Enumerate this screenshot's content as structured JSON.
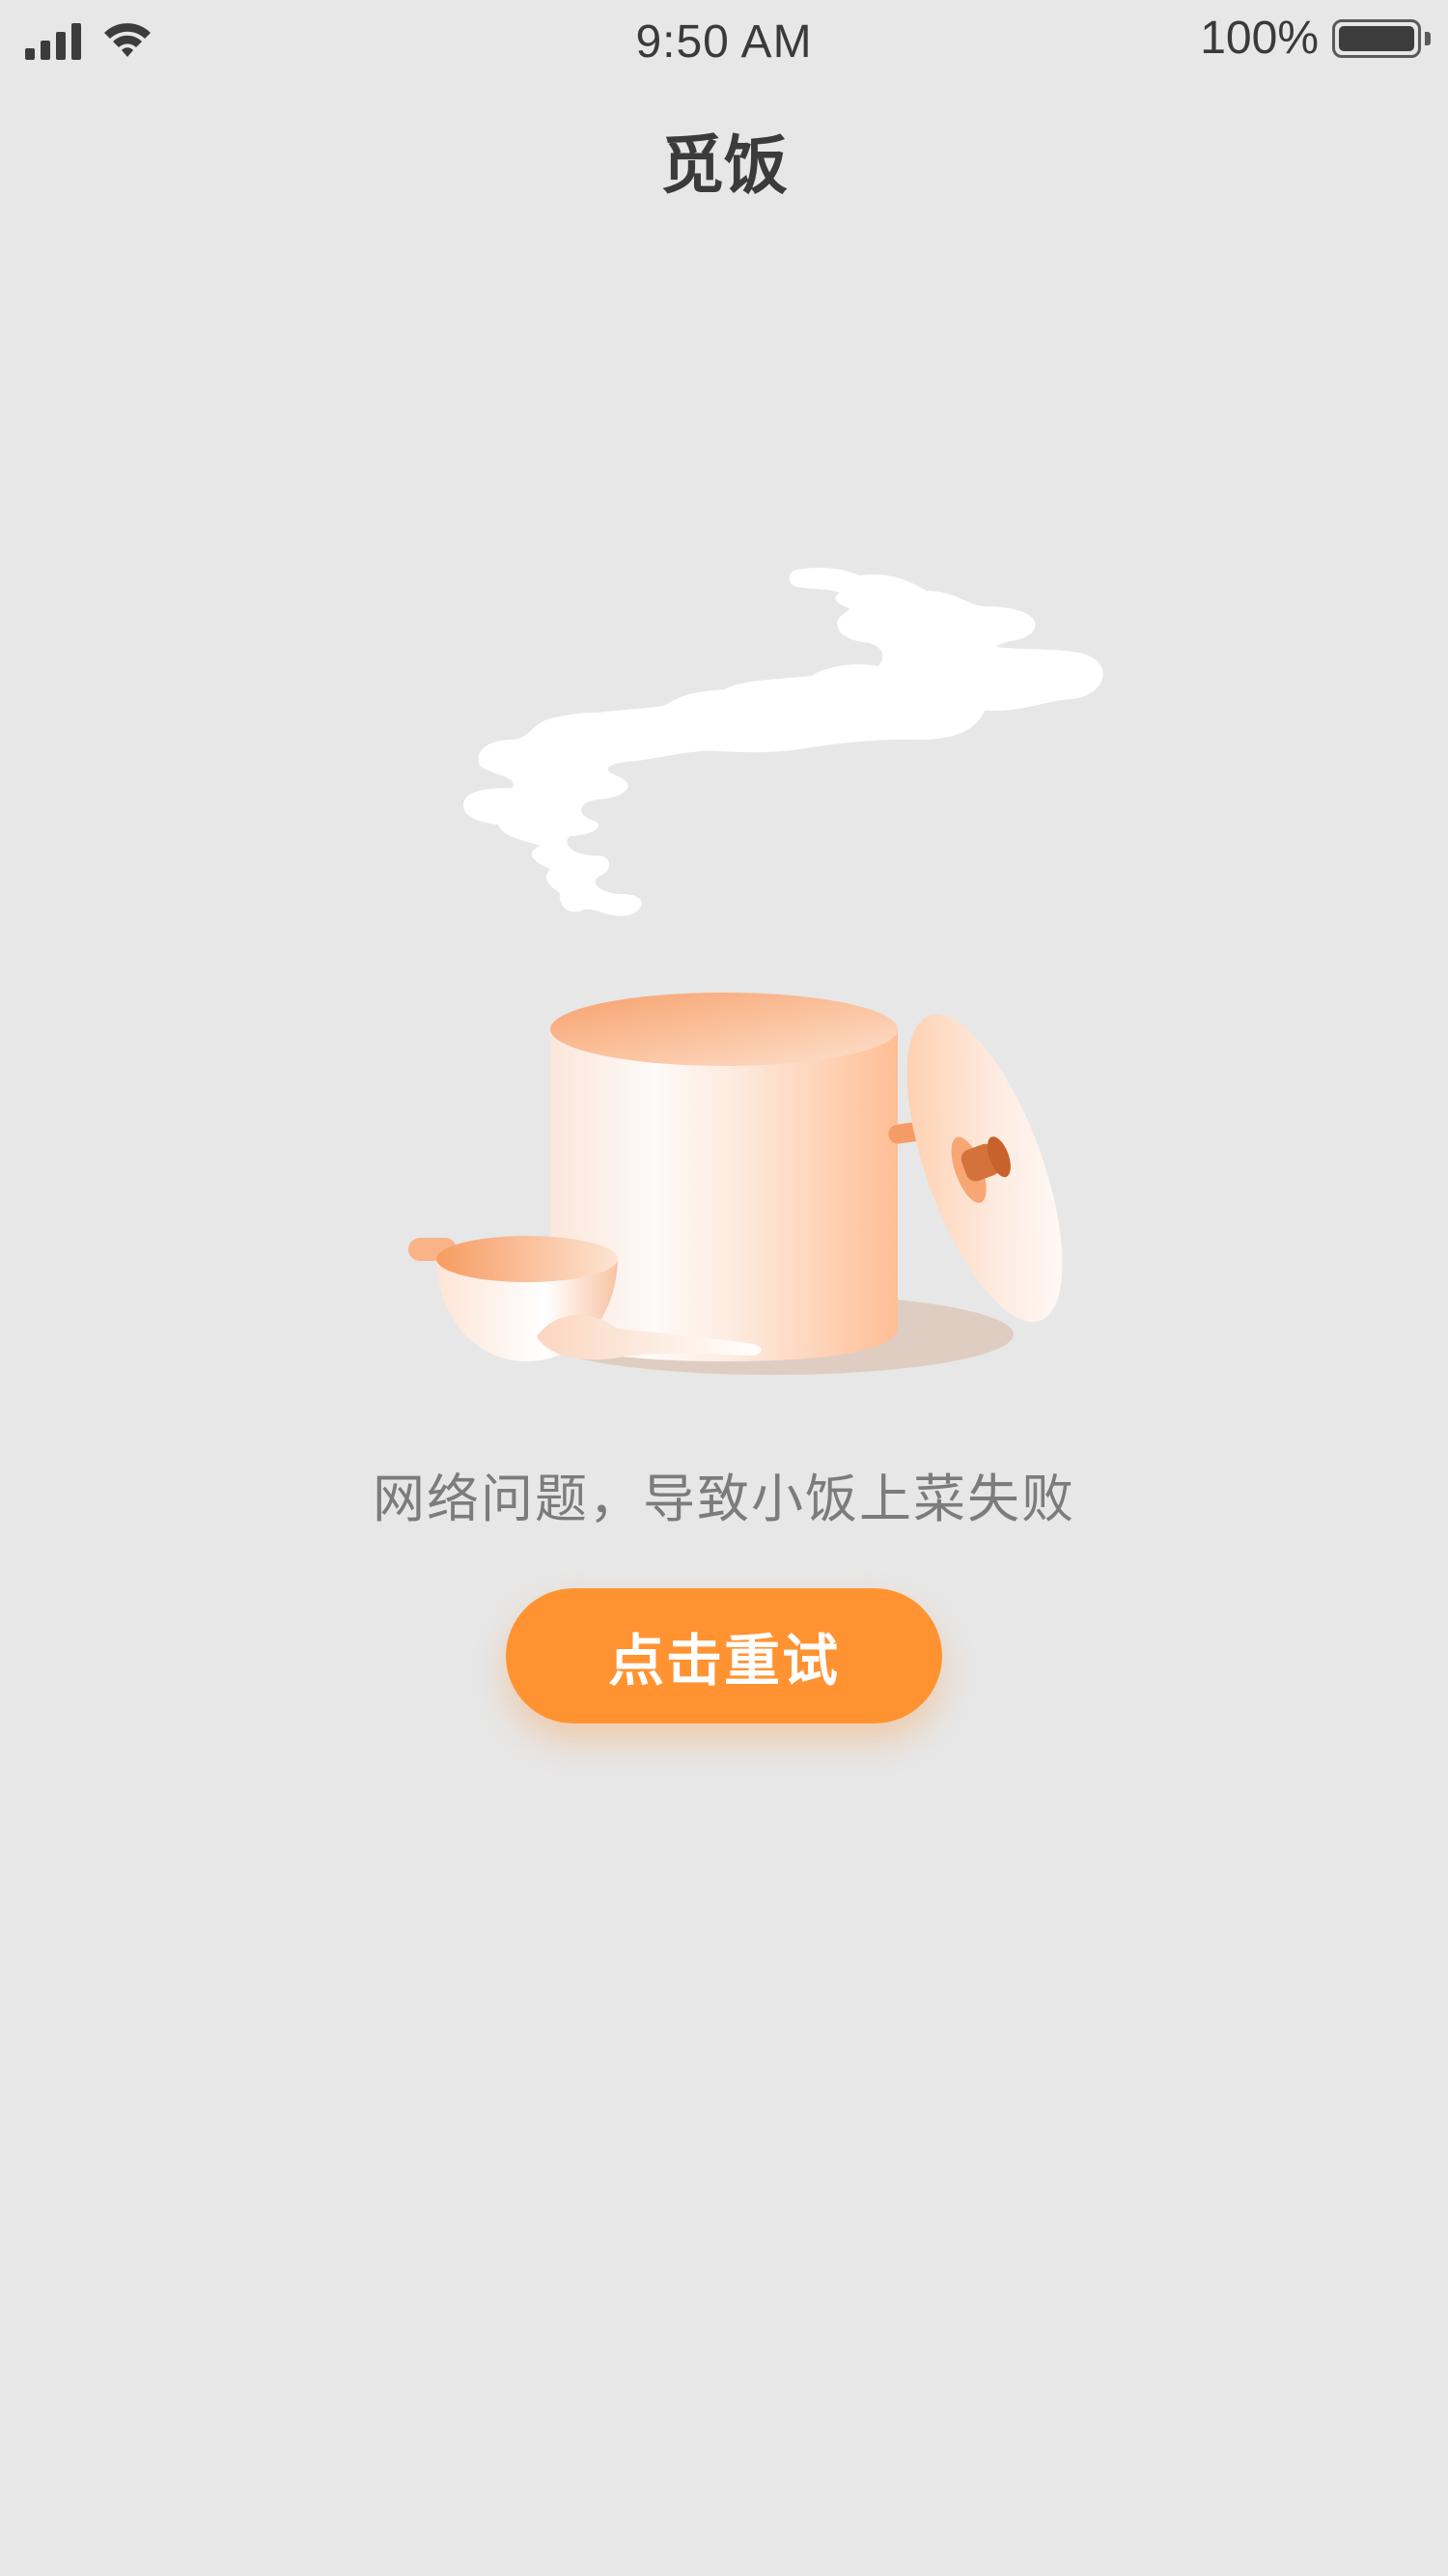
{
  "status_bar": {
    "time": "9:50 AM",
    "battery_percent": "100%",
    "signal_icon": "cellular-signal-icon",
    "wifi_icon": "wifi-icon",
    "battery_icon": "battery-icon",
    "battery_level": 1.0
  },
  "nav": {
    "title": "觅饭"
  },
  "error": {
    "illustration": "cooking-pot-illustration",
    "message": "网络问题，导致小饭上菜失败",
    "retry_label": "点击重试"
  },
  "colors": {
    "background": "#e7e7e7",
    "accent": "#ff9332",
    "title_text": "#3b3b3b",
    "message_text": "#7c7c7c"
  }
}
